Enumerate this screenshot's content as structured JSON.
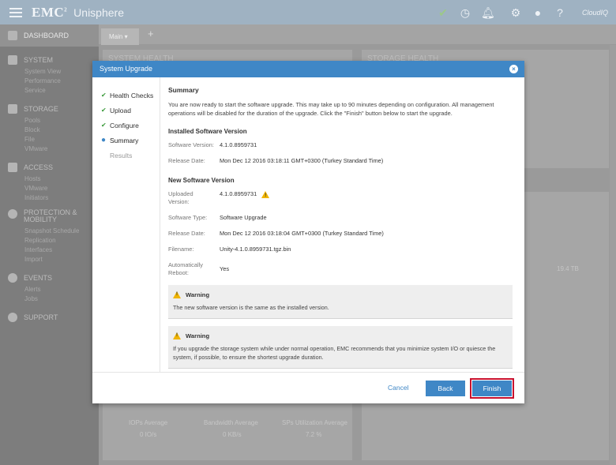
{
  "topbar": {
    "brand": "EMC",
    "brand_sup": "2",
    "product": "Unisphere",
    "cloudiq": "CloudIQ"
  },
  "sidebar": {
    "dashboard": "DASHBOARD",
    "groups": [
      {
        "title": "SYSTEM",
        "items": [
          "System View",
          "Performance",
          "Service"
        ]
      },
      {
        "title": "STORAGE",
        "items": [
          "Pools",
          "Block",
          "File",
          "VMware"
        ]
      },
      {
        "title": "ACCESS",
        "items": [
          "Hosts",
          "VMware",
          "Initiators"
        ]
      },
      {
        "title": "PROTECTION & MOBILITY",
        "items": [
          "Snapshot Schedule",
          "Replication",
          "Interfaces",
          "Import"
        ]
      },
      {
        "title": "EVENTS",
        "items": [
          "Alerts",
          "Jobs"
        ]
      },
      {
        "title": "SUPPORT",
        "items": []
      }
    ]
  },
  "main": {
    "tab": "Main",
    "tab_add": "+",
    "system_health": "SYSTEM HEALTH",
    "storage_health": "STORAGE HEALTH",
    "capacity": "19.4 TB",
    "metrics": [
      {
        "label": "IOPs Average",
        "value": "0 IO/s"
      },
      {
        "label": "Bandwidth Average",
        "value": "0 KB/s"
      },
      {
        "label": "SPs Utilization Average",
        "value": "7.2 %"
      }
    ]
  },
  "dialog": {
    "title": "System Upgrade",
    "close_glyph": "×",
    "steps": [
      {
        "label": "Health Checks",
        "mark": "✔"
      },
      {
        "label": "Upload",
        "mark": "✔"
      },
      {
        "label": "Configure",
        "mark": "✔"
      },
      {
        "label": "Summary",
        "mark": "●"
      },
      {
        "label": "Results",
        "mark": ""
      }
    ],
    "summary": {
      "heading": "Summary",
      "intro": "You are now ready to start the software upgrade. This may take up to 90 minutes depending on configuration. All management operations will be disabled for the duration of the upgrade. Click the \"Finish\" button below to start the upgrade.",
      "installed": {
        "heading": "Installed Software Version",
        "version_label": "Software Version:",
        "version_value": "4.1.0.8959731",
        "date_label": "Release Date:",
        "date_value": "Mon Dec 12 2016 03:18:11 GMT+0300 (Turkey Standard Time)"
      },
      "new": {
        "heading": "New Software Version",
        "uploaded_label": "Uploaded Version:",
        "uploaded_value": "4.1.0.8959731",
        "type_label": "Software Type:",
        "type_value": "Software Upgrade",
        "date_label": "Release Date:",
        "date_value": "Mon Dec 12 2016 03:18:04 GMT+0300 (Turkey Standard Time)",
        "filename_label": "Filename:",
        "filename_value": "Unity-4.1.0.8959731.tgz.bin",
        "reboot_label": "Automatically Reboot:",
        "reboot_value": "Yes"
      },
      "warnings": [
        {
          "title": "Warning",
          "text": "The new software version is the same as the installed version."
        },
        {
          "title": "Warning",
          "text": "If you upgrade the storage system while under normal operation, EMC recommends that you minimize system I/O or quiesce the system, if possible, to ensure the shortest upgrade duration."
        }
      ]
    },
    "buttons": {
      "cancel": "Cancel",
      "back": "Back",
      "finish": "Finish"
    }
  },
  "colors": {
    "accent": "#3f87c6",
    "highlight": "#c8102e",
    "warning": "#f0b400",
    "check": "#3a9a3a"
  }
}
